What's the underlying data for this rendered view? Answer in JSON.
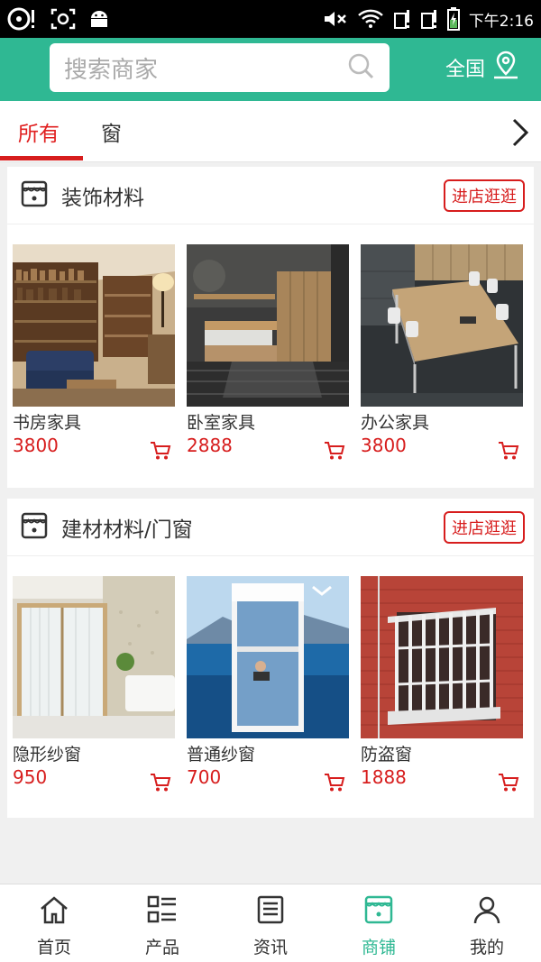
{
  "status_bar": {
    "time": "下午2:16"
  },
  "header": {
    "search_placeholder": "搜索商家",
    "region": "全国"
  },
  "tabs": [
    {
      "label": "所有",
      "active": true
    },
    {
      "label": "窗",
      "active": false
    }
  ],
  "sections": [
    {
      "title": "装饰材料",
      "visit_label": "进店逛逛",
      "products": [
        {
          "name": "书房家具",
          "price": "3800"
        },
        {
          "name": "卧室家具",
          "price": "2888"
        },
        {
          "name": "办公家具",
          "price": "3800"
        }
      ]
    },
    {
      "title": "建材材料/门窗",
      "visit_label": "进店逛逛",
      "products": [
        {
          "name": "隐形纱窗",
          "price": "950"
        },
        {
          "name": "普通纱窗",
          "price": "700"
        },
        {
          "name": "防盗窗",
          "price": "1888"
        }
      ]
    }
  ],
  "bottom_nav": [
    {
      "label": "首页",
      "icon": "home-icon"
    },
    {
      "label": "产品",
      "icon": "list-icon"
    },
    {
      "label": "资讯",
      "icon": "news-icon"
    },
    {
      "label": "商铺",
      "icon": "shop-icon",
      "active": true
    },
    {
      "label": "我的",
      "icon": "user-icon"
    }
  ],
  "colors": {
    "accent": "#2fb893",
    "price": "#d71d1d"
  }
}
